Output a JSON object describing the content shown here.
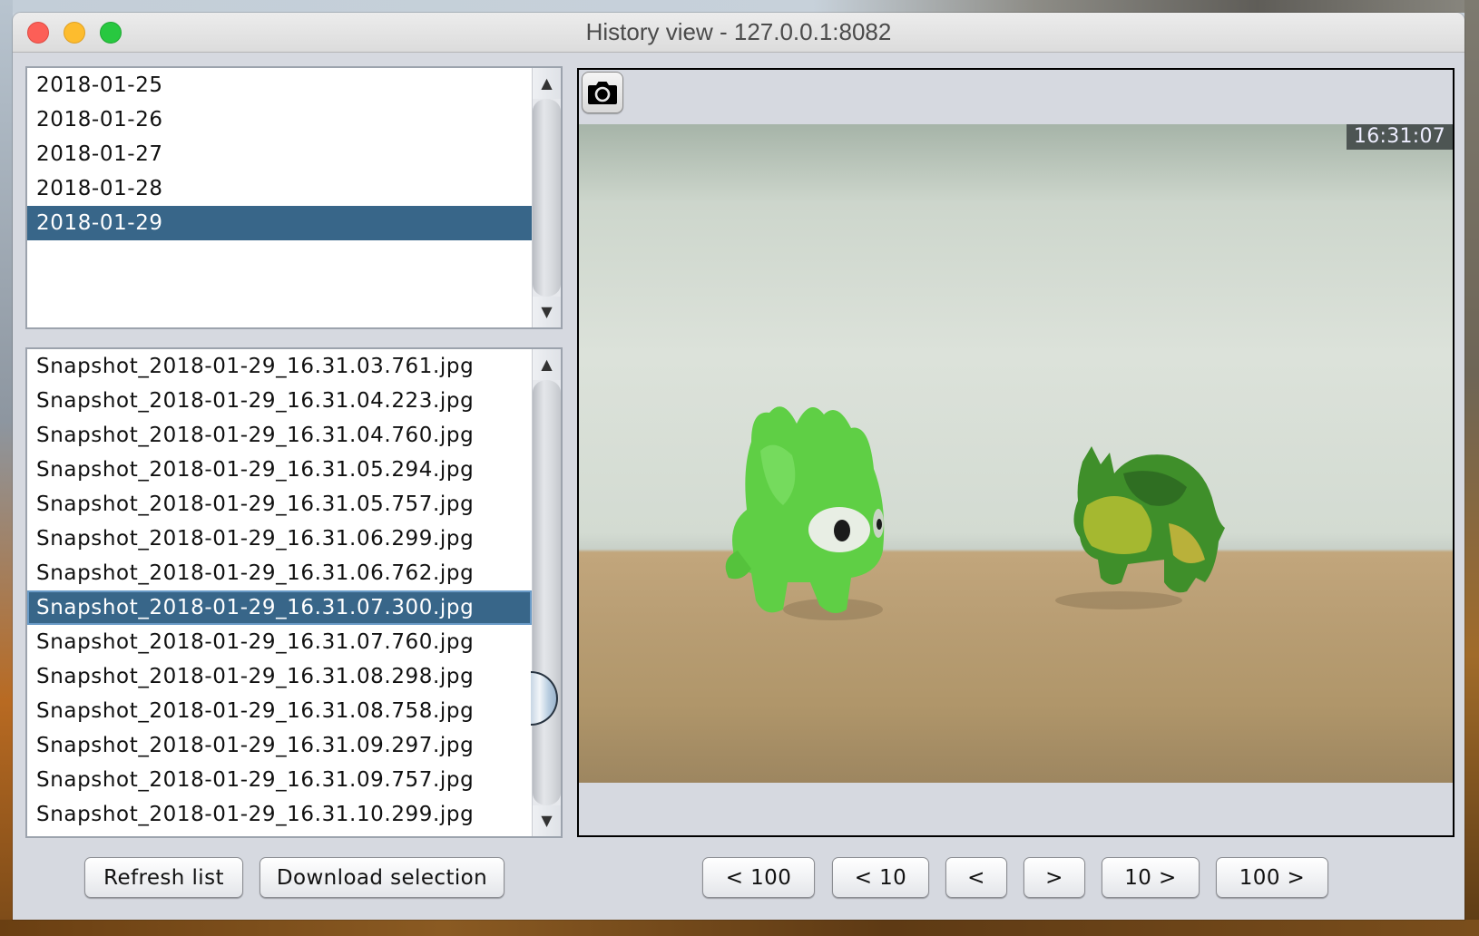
{
  "window": {
    "title": "History view - 127.0.0.1:8082"
  },
  "dates_list": {
    "items": [
      "2018-01-25",
      "2018-01-26",
      "2018-01-27",
      "2018-01-28",
      "2018-01-29"
    ],
    "selected_index": 4
  },
  "files_list": {
    "items": [
      "Snapshot_2018-01-29_16.31.03.761.jpg",
      "Snapshot_2018-01-29_16.31.04.223.jpg",
      "Snapshot_2018-01-29_16.31.04.760.jpg",
      "Snapshot_2018-01-29_16.31.05.294.jpg",
      "Snapshot_2018-01-29_16.31.05.757.jpg",
      "Snapshot_2018-01-29_16.31.06.299.jpg",
      "Snapshot_2018-01-29_16.31.06.762.jpg",
      "Snapshot_2018-01-29_16.31.07.300.jpg",
      "Snapshot_2018-01-29_16.31.07.760.jpg",
      "Snapshot_2018-01-29_16.31.08.298.jpg",
      "Snapshot_2018-01-29_16.31.08.758.jpg",
      "Snapshot_2018-01-29_16.31.09.297.jpg",
      "Snapshot_2018-01-29_16.31.09.757.jpg",
      "Snapshot_2018-01-29_16.31.10.299.jpg"
    ],
    "selected_index": 7
  },
  "scrollbars": {
    "up_arrow": "▲",
    "down_arrow": "▼"
  },
  "viewer": {
    "camera_icon": "camera-icon",
    "timestamp": "16:31:07"
  },
  "left_buttons": {
    "refresh": "Refresh list",
    "download": "Download selection"
  },
  "nav_buttons": {
    "back_100": "< 100",
    "back_10": "< 10",
    "back_1": "<",
    "forward_1": ">",
    "forward_10": "10 >",
    "forward_100": "100 >"
  },
  "colors": {
    "selection": "#386689",
    "window_bg": "#d6d9e0"
  }
}
